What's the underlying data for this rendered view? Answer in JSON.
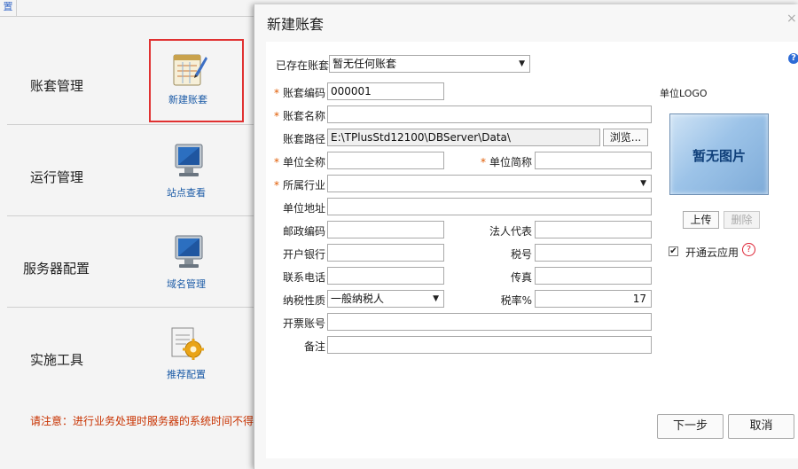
{
  "background": {
    "top_tab_label": "置",
    "sections": [
      {
        "title": "账套管理",
        "tool_label": "新建账套"
      },
      {
        "title": "运行管理",
        "tool_label": "站点查看"
      },
      {
        "title": "服务器配置",
        "tool_label": "域名管理"
      },
      {
        "title": "实施工具",
        "tool_label": "推荐配置"
      }
    ],
    "note": "请注意：进行业务处理时服务器的系统时间不得修改"
  },
  "dialog": {
    "title": "新建账套",
    "close_symbol": "×",
    "help_symbol": "?",
    "required_mark": "*",
    "existing": {
      "label": "已存在账套",
      "value": "暂无任何账套"
    },
    "code": {
      "label": "账套编码",
      "value": "000001"
    },
    "name": {
      "label": "账套名称",
      "value": ""
    },
    "path": {
      "label": "账套路径",
      "value": "E:\\TPlusStd12100\\DBServer\\Data\\",
      "browse_label": "浏览..."
    },
    "full_name": {
      "label": "单位全称",
      "value": ""
    },
    "short_name": {
      "label": "单位简称",
      "value": ""
    },
    "industry": {
      "label": "所属行业",
      "value": ""
    },
    "address": {
      "label": "单位地址",
      "value": ""
    },
    "postcode": {
      "label": "邮政编码",
      "value": ""
    },
    "legal_rep": {
      "label": "法人代表",
      "value": ""
    },
    "bank": {
      "label": "开户银行",
      "value": ""
    },
    "tax_no": {
      "label": "税号",
      "value": ""
    },
    "phone": {
      "label": "联系电话",
      "value": ""
    },
    "fax": {
      "label": "传真",
      "value": ""
    },
    "tax_type": {
      "label": "纳税性质",
      "value": "一般纳税人"
    },
    "tax_rate": {
      "label": "税率%",
      "value": "17"
    },
    "invoice_account": {
      "label": "开票账号",
      "value": ""
    },
    "remark": {
      "label": "备注",
      "value": ""
    },
    "logo": {
      "label": "单位LOGO",
      "placeholder": "暂无图片",
      "upload_label": "上传",
      "delete_label": "删除"
    },
    "cloud": {
      "label": "开通云应用",
      "checked": true,
      "check_symbol": "✔",
      "help_symbol": "?"
    },
    "next_label": "下一步",
    "cancel_label": "取消"
  },
  "colors": {
    "accent_link": "#1a5aa6",
    "required": "#e05a00",
    "highlight_frame": "#e03131",
    "warning_text": "#c83200"
  }
}
